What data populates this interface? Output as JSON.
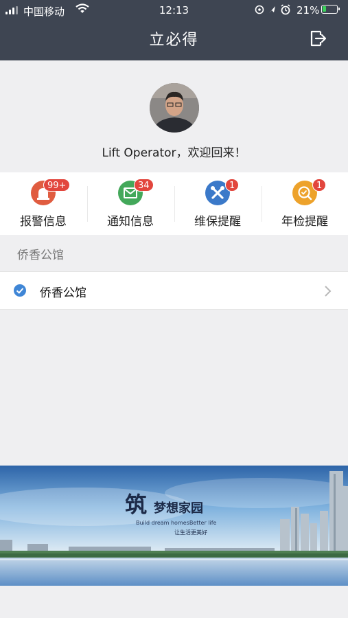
{
  "status_bar": {
    "carrier": "中国移动",
    "time": "12:13",
    "battery": "21%"
  },
  "nav": {
    "title": "立必得",
    "logout_icon": "logout-icon"
  },
  "profile": {
    "welcome": "Lift Operator，欢迎回来！"
  },
  "menu": [
    {
      "label": "报警信息",
      "badge": "99+",
      "icon": "alarm-icon",
      "color": "#e05c40"
    },
    {
      "label": "通知信息",
      "badge": "34",
      "icon": "mail-icon",
      "color": "#43a85a"
    },
    {
      "label": "维保提醒",
      "badge": "1",
      "icon": "tools-icon",
      "color": "#3b79c9"
    },
    {
      "label": "年检提醒",
      "badge": "1",
      "icon": "inspection-icon",
      "color": "#eda22b"
    }
  ],
  "section": {
    "title": "侨香公馆"
  },
  "projects": [
    {
      "label": "侨香公馆",
      "selected": true
    }
  ],
  "banner": {
    "title_big": "筑",
    "title": "梦想家园",
    "subtitle": "Build dream homesBetter life",
    "slogan": "让生活更美好"
  }
}
